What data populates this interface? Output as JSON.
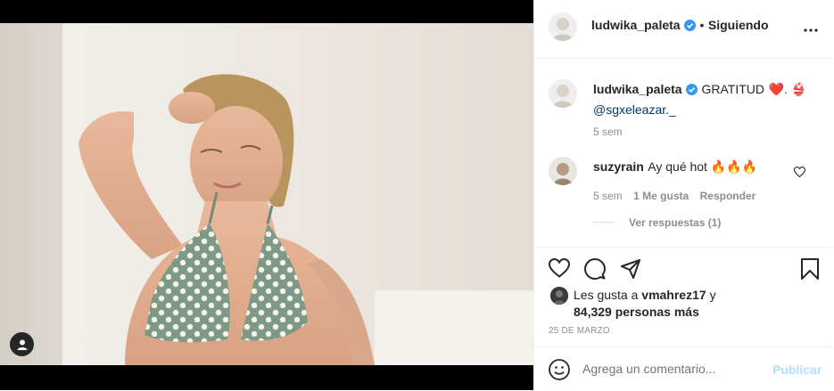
{
  "post": {
    "username": "ludwika_paleta",
    "follow_status": "Siguiendo",
    "separator": "•",
    "more_label": "•••"
  },
  "caption": {
    "username": "ludwika_paleta",
    "text": "GRATITUD",
    "emoji_tail": "❤️. 👙",
    "mention": "@sgxeleazar._",
    "time": "5 sem"
  },
  "comment": {
    "username": "suzyrain",
    "text": "Ay qué hot 🔥🔥🔥",
    "time": "5 sem",
    "likes": "1 Me gusta",
    "reply_label": "Responder",
    "view_replies": "Ver respuestas (1)"
  },
  "likes": {
    "prefix": "Les gusta a",
    "user": "vmahrez17",
    "conj": "y",
    "count_text": "84,329 personas más"
  },
  "date": "25 DE MARZO",
  "add_comment": {
    "placeholder": "Agrega un comentario...",
    "publish_label": "Publicar"
  },
  "colors": {
    "verified": "#3897f0",
    "publish": "#b2dffc",
    "text": "#262626",
    "secondary": "#8e8e8e"
  },
  "icons": [
    "user-tag-icon",
    "verified-icon",
    "more-icon",
    "heart-icon",
    "comment-icon",
    "share-icon",
    "save-icon",
    "emoji-icon",
    "like-comment-icon"
  ]
}
